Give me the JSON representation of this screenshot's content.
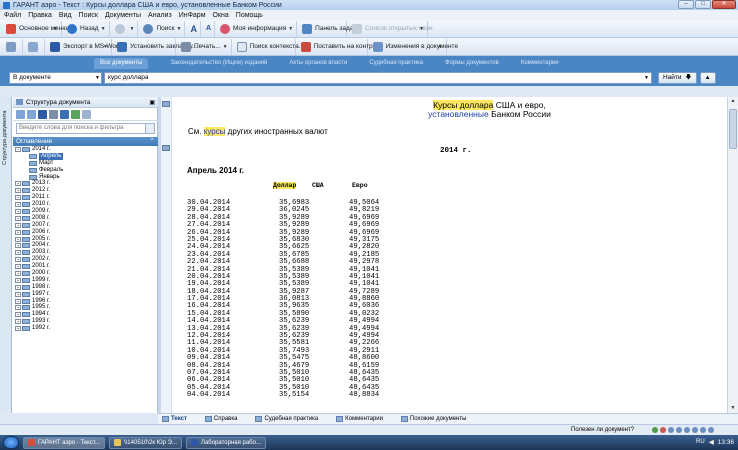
{
  "window": {
    "title": "ГАРАНТ аэро - Текст : Курсы доллара США и евро, установленные Банком России",
    "controls": [
      "–",
      "□",
      "✕"
    ]
  },
  "menu": [
    "Файл",
    "Правка",
    "Вид",
    "Поиск",
    "Документы",
    "Анализ",
    "ИнФарм",
    "Окна",
    "Помощь"
  ],
  "toolbar1": {
    "main_menu": "Основное меню",
    "back": "Назад",
    "forward": "",
    "search": "Поиск",
    "zoom_in": "A",
    "zoom_out": "A",
    "my_info": "Моя информация",
    "task_panel": "Панель задач",
    "open_windows": "Список открытых окон"
  },
  "toolbar2": {
    "export": "Экспорт в MS-Word",
    "bookmark": "Установить закладку...",
    "print": "Печать...",
    "context_search": "Поиск контекста...",
    "monitor": "Поставить на контроль",
    "changes": "Изменения в документе"
  },
  "tabs": [
    "Все документы",
    "Законодательство (Ищкм) изданий",
    "Акты органов власти",
    "Судебная практика",
    "Формы документов",
    "Комментарии"
  ],
  "search": {
    "scope": "В документе",
    "query": "курс доллара",
    "find_label": "Найти"
  },
  "sidebar": {
    "vertical_tab": "Структура документа",
    "header": "Структура документа",
    "filter_placeholder": "Введите слова для поиска и фильтра",
    "toc_title": "Оглавление",
    "toc": [
      {
        "label": "2014 г.",
        "level": 0,
        "expanded": true
      },
      {
        "label": "Апрель",
        "level": 1,
        "selected": true
      },
      {
        "label": "Март",
        "level": 1
      },
      {
        "label": "Февраль",
        "level": 1
      },
      {
        "label": "Январь",
        "level": 1
      },
      {
        "label": "2013 г.",
        "level": 0
      },
      {
        "label": "2012 г.",
        "level": 0
      },
      {
        "label": "2011 г.",
        "level": 0
      },
      {
        "label": "2010 г.",
        "level": 0
      },
      {
        "label": "2009 г.",
        "level": 0
      },
      {
        "label": "2008 г.",
        "level": 0
      },
      {
        "label": "2007 г.",
        "level": 0
      },
      {
        "label": "2006 г.",
        "level": 0
      },
      {
        "label": "2005 г.",
        "level": 0
      },
      {
        "label": "2004 г.",
        "level": 0
      },
      {
        "label": "2003 г.",
        "level": 0
      },
      {
        "label": "2002 г.",
        "level": 0
      },
      {
        "label": "2001 г.",
        "level": 0
      },
      {
        "label": "2000 г.",
        "level": 0
      },
      {
        "label": "1999 г.",
        "level": 0
      },
      {
        "label": "1998 г.",
        "level": 0
      },
      {
        "label": "1997 г.",
        "level": 0
      },
      {
        "label": "1996 г.",
        "level": 0
      },
      {
        "label": "1995 г.",
        "level": 0
      },
      {
        "label": "1994 г.",
        "level": 0
      },
      {
        "label": "1993 г.",
        "level": 0
      },
      {
        "label": "1992 г.",
        "level": 0
      }
    ]
  },
  "document": {
    "title_part1": "Курсы доллара",
    "title_part2": " США и евро,",
    "title2_link": "установленные",
    "title2_rest": " Банком России",
    "see_prefix": "См. ",
    "see_highlight": "курсы",
    "see_rest": " других иностранных валют",
    "year": "2014 г.",
    "month": "Апрель 2014 г.",
    "col_headers": {
      "dollar": "Доллар",
      "usa": "США",
      "euro": "Евро"
    },
    "rows": [
      [
        "30.04.2014",
        "35,6983",
        "49,5064"
      ],
      [
        "29.04.2014",
        "36,0245",
        "49,8219"
      ],
      [
        "28.04.2014",
        "35,9289",
        "49,6969"
      ],
      [
        "27.04.2014",
        "35,9289",
        "49,6969"
      ],
      [
        "26.04.2014",
        "35,9289",
        "49,6969"
      ],
      [
        "25.04.2014",
        "35,6830",
        "49,3175"
      ],
      [
        "24.04.2014",
        "35,6625",
        "49,2820"
      ],
      [
        "23.04.2014",
        "35,6785",
        "49,2185"
      ],
      [
        "22.04.2014",
        "35,6688",
        "49,2978"
      ],
      [
        "21.04.2014",
        "35,5389",
        "49,1041"
      ],
      [
        "20.04.2014",
        "35,5389",
        "49,1041"
      ],
      [
        "19.04.2014",
        "35,5389",
        "49,1041"
      ],
      [
        "18.04.2014",
        "35,9287",
        "49,7289"
      ],
      [
        "17.04.2014",
        "36,0813",
        "49,8860"
      ],
      [
        "16.04.2014",
        "35,9635",
        "49,6036"
      ],
      [
        "15.04.2014",
        "35,5890",
        "49,0232"
      ],
      [
        "14.04.2014",
        "35,6239",
        "49,4994"
      ],
      [
        "13.04.2014",
        "35,6239",
        "49,4994"
      ],
      [
        "12.04.2014",
        "35,6239",
        "49,4994"
      ],
      [
        "11.04.2014",
        "35,5581",
        "49,2266"
      ],
      [
        "10.04.2014",
        "35,7493",
        "49,2911"
      ],
      [
        "09.04.2014",
        "35,5475",
        "48,8600"
      ],
      [
        "08.04.2014",
        "35,4679",
        "48,6159"
      ],
      [
        "07.04.2014",
        "35,5010",
        "48,6435"
      ],
      [
        "06.04.2014",
        "35,5010",
        "48,6435"
      ],
      [
        "05.04.2014",
        "35,5010",
        "48,6435"
      ],
      [
        "04.04.2014",
        "35,5154",
        "48,8834"
      ]
    ]
  },
  "bottom_tabs": [
    "Текст",
    "Справка",
    "Судебная практика",
    "Комментарии",
    "Похожие документы"
  ],
  "status": {
    "question": "Полезен ли документ?"
  },
  "taskbar": {
    "tasks": [
      "ГАРАНТ аэро - Текст...",
      "\\\\140510\\2к Юр Э...",
      "Лабораторная рабо..."
    ],
    "lang": "RU",
    "clock": "13:36"
  },
  "colors": {
    "accent": "#4a85c4",
    "highlight": "#fbe860",
    "link": "#1f3fa8"
  }
}
